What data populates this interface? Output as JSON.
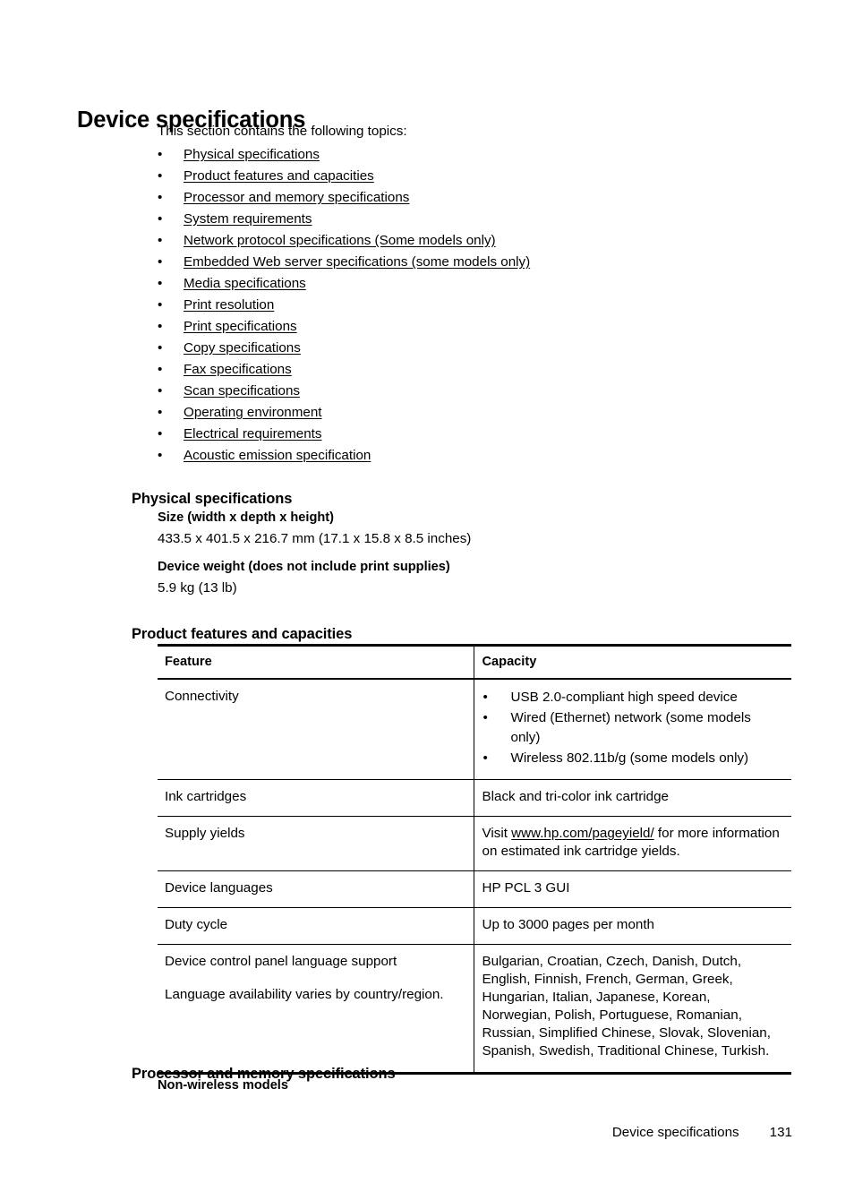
{
  "document": {
    "title": "Device specifications",
    "intro": "This section contains the following topics:"
  },
  "toc": {
    "bullet": "•",
    "items": [
      {
        "label": "Physical specifications"
      },
      {
        "label": "Product features and capacities"
      },
      {
        "label": "Processor and memory specifications"
      },
      {
        "label": "System requirements"
      },
      {
        "label": "Network protocol specifications (Some models only)"
      },
      {
        "label": "Embedded Web server specifications (some models only)"
      },
      {
        "label": "Media specifications"
      },
      {
        "label": "Print resolution"
      },
      {
        "label": "Print specifications"
      },
      {
        "label": "Copy specifications"
      },
      {
        "label": "Fax specifications"
      },
      {
        "label": "Scan specifications"
      },
      {
        "label": "Operating environment"
      },
      {
        "label": "Electrical requirements"
      },
      {
        "label": "Acoustic emission specification"
      }
    ]
  },
  "physical_specifications": {
    "heading": "Physical specifications",
    "size_label": "Size (width x depth x height)",
    "size_value": "433.5 x 401.5 x 216.7 mm (17.1 x 15.8 x 8.5 inches)",
    "weight_label": "Device weight (does not include print supplies)",
    "weight_value": "5.9 kg (13 lb)"
  },
  "product_features": {
    "heading": "Product features and capacities",
    "columns": [
      "Feature",
      "Capacity"
    ],
    "rows": [
      {
        "feature": "Connectivity",
        "capacity_bullets": [
          "USB 2.0-compliant high speed device",
          "Wired (Ethernet) network (some models only)",
          "Wireless 802.11b/g (some models only)"
        ]
      },
      {
        "feature": "Ink cartridges",
        "capacity_text": "Black and tri-color ink cartridge"
      },
      {
        "feature": "Supply yields",
        "capacity_prefix": "Visit ",
        "capacity_link": "www.hp.com/pageyield/",
        "capacity_suffix": " for more information on estimated ink cartridge yields."
      },
      {
        "feature": "Device languages",
        "capacity_text": "HP PCL 3 GUI"
      },
      {
        "feature": "Duty cycle",
        "capacity_text": "Up to 3000 pages per month"
      },
      {
        "feature": "Device control panel language support",
        "feature_note": "Language availability varies by country/region.",
        "capacity_text": "Bulgarian, Croatian, Czech, Danish, Dutch, English, Finnish, French, German, Greek, Hungarian, Italian, Japanese, Korean, Norwegian, Polish, Portuguese, Romanian, Russian, Simplified Chinese, Slovak, Slovenian, Spanish, Swedish, Traditional Chinese, Turkish."
      }
    ],
    "bullet": "•"
  },
  "processor_memory": {
    "heading": "Processor and memory specifications",
    "subheading": "Non-wireless models"
  },
  "footer": {
    "title": "Device specifications",
    "page_number": "131"
  }
}
